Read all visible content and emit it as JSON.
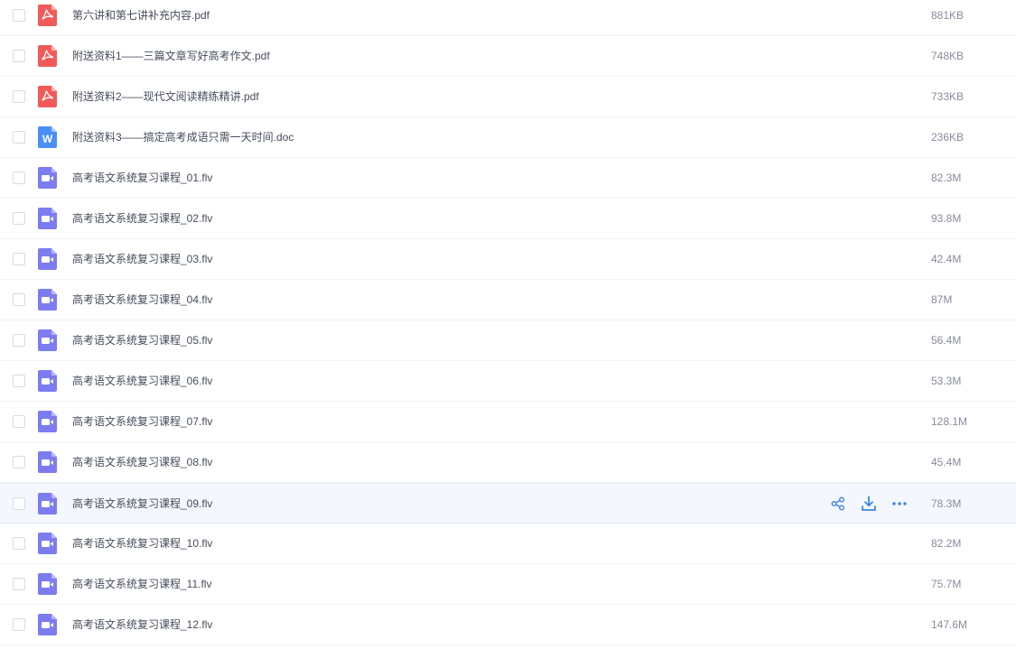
{
  "colors": {
    "pdf": "#f25a5a",
    "doc": "#4a8ff5",
    "video": "#7c7cf0",
    "action": "#3b86e6",
    "hover_bg": "#f4f8fe"
  },
  "row_actions": [
    {
      "name": "share-icon"
    },
    {
      "name": "download-icon"
    },
    {
      "name": "more-icon"
    }
  ],
  "files": [
    {
      "type": "pdf",
      "icon": "pdf-icon",
      "name": "第六讲和第七讲补充内容.pdf",
      "size": "881KB",
      "hovered": false
    },
    {
      "type": "pdf",
      "icon": "pdf-icon",
      "name": "附送资料1——三篇文章写好高考作文.pdf",
      "size": "748KB",
      "hovered": false
    },
    {
      "type": "pdf",
      "icon": "pdf-icon",
      "name": "附送资料2——现代文阅读精练精讲.pdf",
      "size": "733KB",
      "hovered": false
    },
    {
      "type": "doc",
      "icon": "word-icon",
      "name": "附送资料3——搞定高考成语只需一天时间.doc",
      "size": "236KB",
      "hovered": false
    },
    {
      "type": "video",
      "icon": "video-icon",
      "name": "高考语文系统复习课程_01.flv",
      "size": "82.3M",
      "hovered": false
    },
    {
      "type": "video",
      "icon": "video-icon",
      "name": "高考语文系统复习课程_02.flv",
      "size": "93.8M",
      "hovered": false
    },
    {
      "type": "video",
      "icon": "video-icon",
      "name": "高考语文系统复习课程_03.flv",
      "size": "42.4M",
      "hovered": false
    },
    {
      "type": "video",
      "icon": "video-icon",
      "name": "高考语文系统复习课程_04.flv",
      "size": "87M",
      "hovered": false
    },
    {
      "type": "video",
      "icon": "video-icon",
      "name": "高考语文系统复习课程_05.flv",
      "size": "56.4M",
      "hovered": false
    },
    {
      "type": "video",
      "icon": "video-icon",
      "name": "高考语文系统复习课程_06.flv",
      "size": "53.3M",
      "hovered": false
    },
    {
      "type": "video",
      "icon": "video-icon",
      "name": "高考语文系统复习课程_07.flv",
      "size": "128.1M",
      "hovered": false
    },
    {
      "type": "video",
      "icon": "video-icon",
      "name": "高考语文系统复习课程_08.flv",
      "size": "45.4M",
      "hovered": false
    },
    {
      "type": "video",
      "icon": "video-icon",
      "name": "高考语文系统复习课程_09.flv",
      "size": "78.3M",
      "hovered": true
    },
    {
      "type": "video",
      "icon": "video-icon",
      "name": "高考语文系统复习课程_10.flv",
      "size": "82.2M",
      "hovered": false
    },
    {
      "type": "video",
      "icon": "video-icon",
      "name": "高考语文系统复习课程_11.flv",
      "size": "75.7M",
      "hovered": false
    },
    {
      "type": "video",
      "icon": "video-icon",
      "name": "高考语文系统复习课程_12.flv",
      "size": "147.6M",
      "hovered": false
    }
  ]
}
